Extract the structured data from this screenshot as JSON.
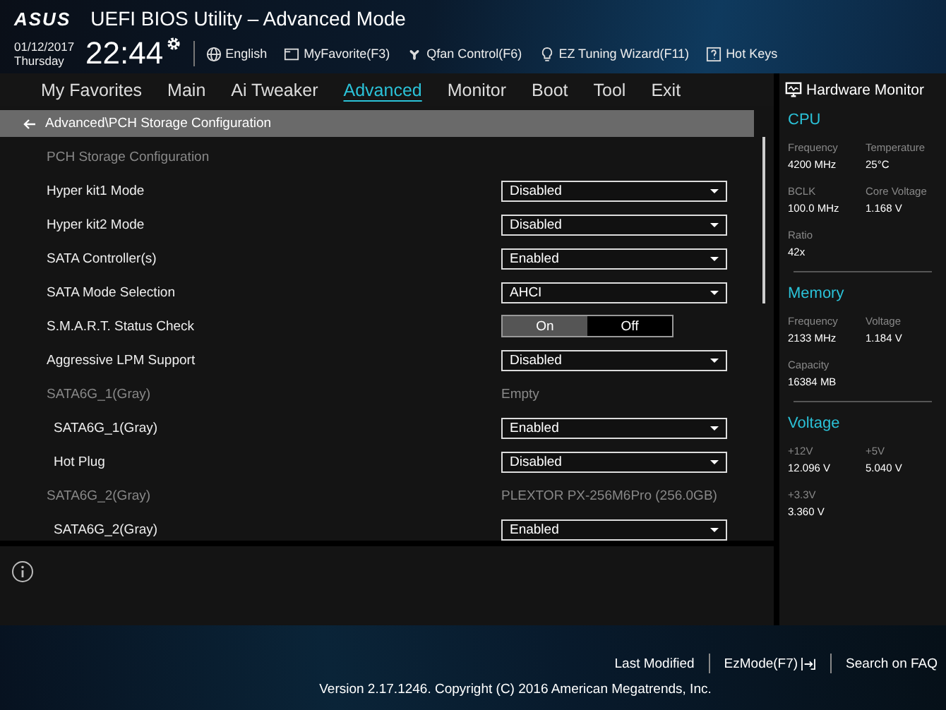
{
  "header": {
    "logo": "ASUS",
    "title": "UEFI BIOS Utility – Advanced Mode",
    "date": "01/12/2017",
    "day": "Thursday",
    "time": "22:44",
    "toolbar": [
      {
        "label": "English"
      },
      {
        "label": "MyFavorite(F3)"
      },
      {
        "label": "Qfan Control(F6)"
      },
      {
        "label": "EZ Tuning Wizard(F11)"
      },
      {
        "label": "Hot Keys"
      }
    ]
  },
  "tabs": [
    {
      "label": "My Favorites",
      "selected": false
    },
    {
      "label": "Main",
      "selected": false
    },
    {
      "label": "Ai Tweaker",
      "selected": false
    },
    {
      "label": "Advanced",
      "selected": true
    },
    {
      "label": "Monitor",
      "selected": false
    },
    {
      "label": "Boot",
      "selected": false
    },
    {
      "label": "Tool",
      "selected": false
    },
    {
      "label": "Exit",
      "selected": false
    }
  ],
  "breadcrumb": "Advanced\\PCH Storage Configuration",
  "settings": [
    {
      "kind": "heading",
      "label": "PCH Storage Configuration"
    },
    {
      "kind": "dropdown",
      "label": "Hyper kit1 Mode",
      "value": "Disabled"
    },
    {
      "kind": "dropdown",
      "label": "Hyper kit2 Mode",
      "value": "Disabled"
    },
    {
      "kind": "dropdown",
      "label": "SATA Controller(s)",
      "value": "Enabled"
    },
    {
      "kind": "dropdown",
      "label": "SATA Mode Selection",
      "value": "AHCI"
    },
    {
      "kind": "toggle",
      "label": "S.M.A.R.T. Status Check",
      "options": [
        {
          "label": "On",
          "selected": true
        },
        {
          "label": "Off",
          "selected": false
        }
      ]
    },
    {
      "kind": "dropdown",
      "label": "Aggressive LPM Support",
      "value": "Disabled"
    },
    {
      "kind": "info",
      "label": "SATA6G_1(Gray)",
      "value": "Empty",
      "children": [
        {
          "kind": "dropdown",
          "label": "SATA6G_1(Gray)",
          "value": "Enabled"
        },
        {
          "kind": "dropdown",
          "label": "Hot Plug",
          "value": "Disabled"
        }
      ]
    },
    {
      "kind": "info",
      "label": "SATA6G_2(Gray)",
      "value": "PLEXTOR PX-256M6Pro (256.0GB)",
      "children": [
        {
          "kind": "dropdown",
          "label": "SATA6G_2(Gray)",
          "value": "Enabled"
        }
      ]
    }
  ],
  "hardware_monitor": {
    "title": "Hardware Monitor",
    "sections": [
      {
        "title": "CPU",
        "items": [
          {
            "label": "Frequency",
            "value": "4200 MHz"
          },
          {
            "label": "Temperature",
            "value": "25°C"
          },
          {
            "label": "BCLK",
            "value": "100.0 MHz"
          },
          {
            "label": "Core Voltage",
            "value": "1.168 V"
          },
          {
            "label": "Ratio",
            "value": "42x"
          }
        ]
      },
      {
        "title": "Memory",
        "items": [
          {
            "label": "Frequency",
            "value": "2133 MHz"
          },
          {
            "label": "Voltage",
            "value": "1.184 V"
          },
          {
            "label": "Capacity",
            "value": "16384 MB"
          }
        ]
      },
      {
        "title": "Voltage",
        "items": [
          {
            "label": "+12V",
            "value": "12.096 V"
          },
          {
            "label": "+5V",
            "value": "5.040 V"
          },
          {
            "label": "+3.3V",
            "value": "3.360 V"
          }
        ]
      }
    ]
  },
  "footer": {
    "links": [
      "Last Modified",
      "EzMode(F7)",
      "Search on FAQ"
    ],
    "version": "Version 2.17.1246. Copyright (C) 2016 American Megatrends, Inc."
  }
}
